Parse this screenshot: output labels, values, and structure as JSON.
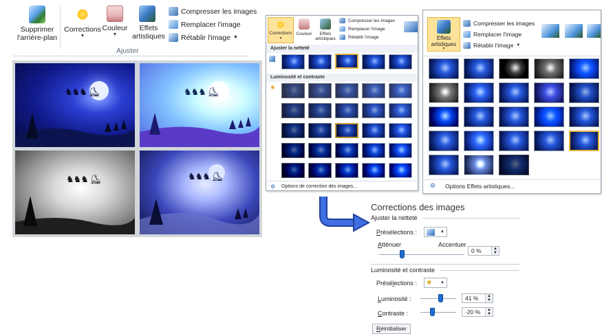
{
  "ribbon": {
    "remove_bg": "Supprimer l'arrière-plan",
    "corrections": "Corrections",
    "color": "Couleur",
    "artistic": "Effets artistiques",
    "compress": "Compresser les images",
    "replace": "Remplacer l'image",
    "reset": "Rétablir l'image",
    "group": "Ajuster"
  },
  "corr_menu": {
    "corrections": "Corrections",
    "color": "Couleur",
    "artistic": "Effets artistiques",
    "compress": "Compresser les images",
    "replace": "Remplacer l'image",
    "reset": "Rétablir l'image",
    "sharpen_header": "Ajuster la netteté",
    "bright_header": "Luminosité et contraste",
    "options": "Options de correction des images..."
  },
  "art_menu": {
    "artistic": "Effets artistiques",
    "compress": "Compresser les images",
    "replace": "Remplacer l'image",
    "reset": "Rétablir l'image",
    "options": "Options Effets artistiques..."
  },
  "dialog": {
    "title": "Corrections des images",
    "sharpen_section": "Ajuster la netteté",
    "presets": "Présélections :",
    "soften": "Atténuer",
    "sharpen": "Accentuer",
    "sharpness_value": "0 %",
    "bright_section": "Luminosité et contraste",
    "presets2": "Présélections :",
    "brightness_label": "Luminosité :",
    "brightness_value": "41 %",
    "contrast_label": "Contraste :",
    "contrast_value": "-20 %",
    "reset_button": "Réinitialiser"
  },
  "icons": {
    "remove_bg": "remove-background-icon",
    "corrections": "sun-icon",
    "color": "color-picture-icon",
    "artistic": "artistic-brush-icon",
    "compress": "compress-icon",
    "replace": "replace-image-icon",
    "reset": "reset-image-icon",
    "arrow": "curved-arrow-icon"
  },
  "colors": {
    "accent": "#1f6fd1",
    "selection": "#e6b43c",
    "night": "#0a1f6e"
  }
}
